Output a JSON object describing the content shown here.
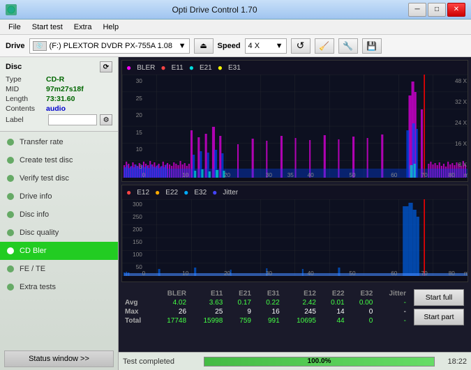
{
  "titlebar": {
    "icon": "⬡",
    "title": "Opti Drive Control 1.70",
    "minimize": "─",
    "maximize": "□",
    "close": "✕"
  },
  "menubar": {
    "items": [
      "File",
      "Start test",
      "Extra",
      "Help"
    ]
  },
  "drivebar": {
    "drive_label": "Drive",
    "drive_value": "(F:)  PLEXTOR DVDR  PX-755A 1.08",
    "speed_label": "Speed",
    "speed_value": "4 X"
  },
  "sidebar": {
    "disc_header": "Disc",
    "disc_type_key": "Type",
    "disc_type_val": "CD-R",
    "disc_mid_key": "MID",
    "disc_mid_val": "97m27s18f",
    "disc_length_key": "Length",
    "disc_length_val": "73:31.60",
    "disc_contents_key": "Contents",
    "disc_contents_val": "audio",
    "disc_label_key": "Label",
    "nav_items": [
      {
        "id": "transfer-rate",
        "label": "Transfer rate"
      },
      {
        "id": "create-test-disc",
        "label": "Create test disc"
      },
      {
        "id": "verify-test-disc",
        "label": "Verify test disc"
      },
      {
        "id": "drive-info",
        "label": "Drive info"
      },
      {
        "id": "disc-info",
        "label": "Disc info"
      },
      {
        "id": "disc-quality",
        "label": "Disc quality"
      },
      {
        "id": "cd-bler",
        "label": "CD Bler",
        "active": true
      },
      {
        "id": "fe-te",
        "label": "FE / TE"
      },
      {
        "id": "extra-tests",
        "label": "Extra tests"
      }
    ],
    "status_btn": "Status window >>"
  },
  "chart": {
    "title_top": "CD Bler",
    "legend_top": [
      "BLER",
      "E11",
      "E21",
      "E31"
    ],
    "legend_top_colors": [
      "#ff00ff",
      "#ff4444",
      "#00dddd",
      "#ffff00"
    ],
    "legend_bottom": [
      "E12",
      "E22",
      "E32",
      "Jitter"
    ],
    "legend_bottom_colors": [
      "#ff4444",
      "#ffaa00",
      "#00aaff",
      "#4444ff"
    ],
    "y_top": [
      "30",
      "25",
      "20",
      "15",
      "10",
      "5"
    ],
    "y_bottom": [
      "300",
      "250",
      "200",
      "150",
      "100",
      "50"
    ],
    "x_labels": [
      "0",
      "10",
      "20",
      "30",
      "35",
      "40",
      "50",
      "60",
      "70",
      "80"
    ],
    "right_top": [
      "48 X",
      "32 X",
      "24 X",
      "16 X",
      "8 X"
    ],
    "right_bottom": []
  },
  "stats": {
    "headers": [
      "",
      "BLER",
      "E11",
      "E21",
      "E31",
      "E12",
      "E22",
      "E32",
      "Jitter"
    ],
    "rows": [
      {
        "label": "Avg",
        "vals": [
          "4.02",
          "3.63",
          "0.17",
          "0.22",
          "2.42",
          "0.01",
          "0.00",
          "-"
        ]
      },
      {
        "label": "Max",
        "vals": [
          "26",
          "25",
          "9",
          "16",
          "245",
          "14",
          "0",
          "-"
        ]
      },
      {
        "label": "Total",
        "vals": [
          "17748",
          "15998",
          "759",
          "991",
          "10695",
          "44",
          "0",
          "-"
        ]
      }
    ]
  },
  "actions": {
    "start_full": "Start full",
    "start_part": "Start part"
  },
  "bottombar": {
    "status": "Test completed",
    "progress": "100.0%",
    "progress_pct": 100,
    "time": "18:22"
  }
}
